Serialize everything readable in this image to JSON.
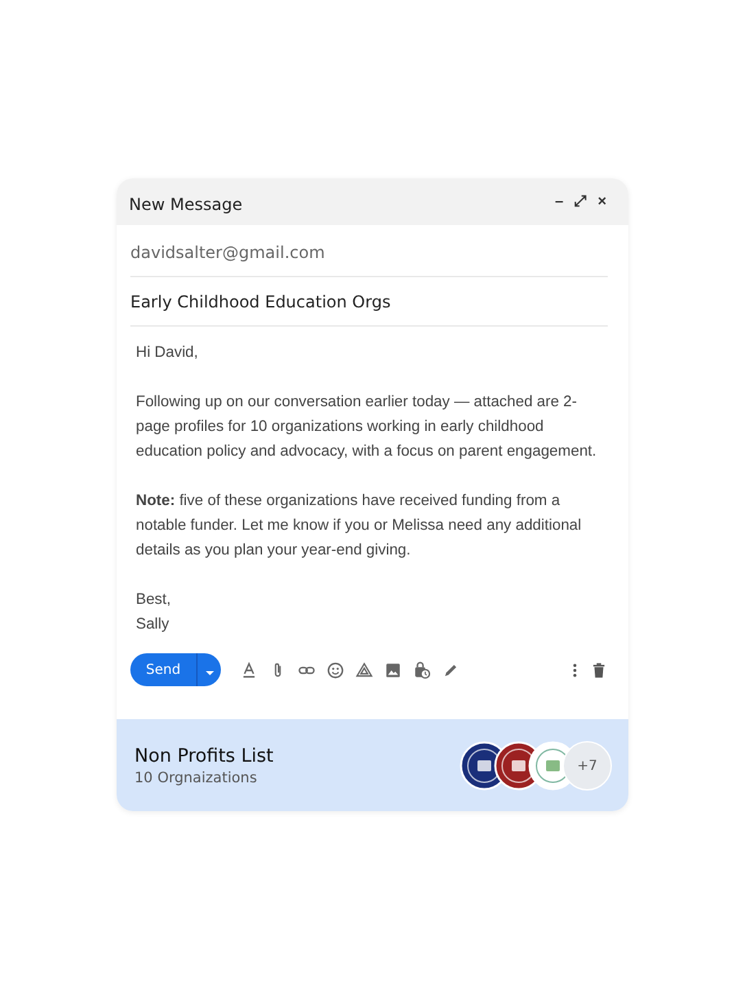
{
  "window": {
    "title": "New Message",
    "controls": [
      "–",
      "⤢",
      "×"
    ]
  },
  "to": "davidsalter@gmail.com",
  "subject": "Early Childhood Education Orgs",
  "body": [
    "Hi David,",
    "Following up on our conversation earlier today — attached are 2-page profiles for 10 organizations working in early childhood education policy and advocacy, with a focus on parent engagement.",
    "**Note:** five of these organizations have received funding from a notable funder. Let me know if you or Melissa need any additional details as you plan your year-end giving.",
    "Best,\nSally"
  ],
  "send_button": "Send",
  "list_panel": {
    "title": "Non Profits List",
    "subtitle": "10 Orgnaizations",
    "logos": [
      {
        "color": "#1a2f7a"
      },
      {
        "color": "#9c2222"
      },
      {
        "color": "#ffffff"
      }
    ],
    "more": "+7"
  }
}
